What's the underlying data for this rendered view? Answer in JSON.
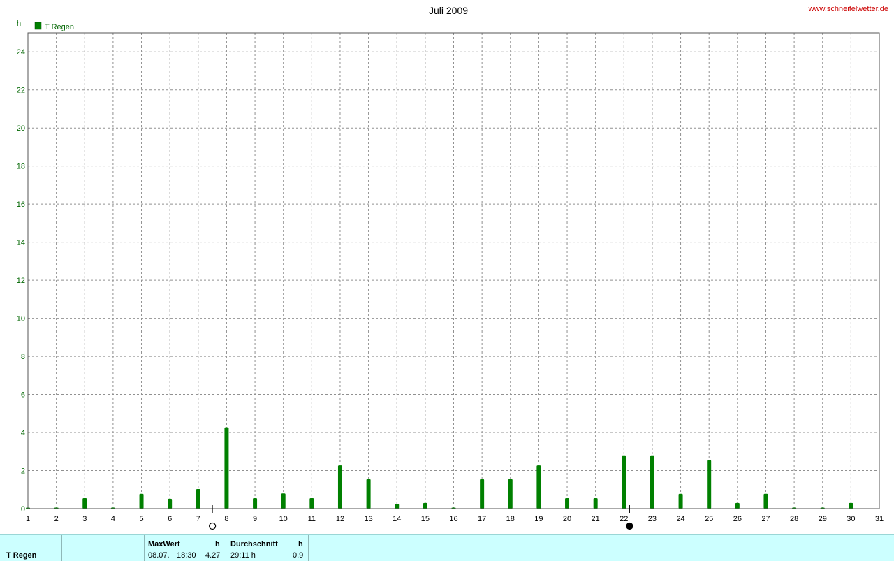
{
  "header": {
    "title": "Juli 2009",
    "site": "www.schneifelwetter.de",
    "y_unit": "h"
  },
  "chart_data": {
    "type": "bar",
    "title": "Juli 2009",
    "xlabel": "",
    "ylabel": "h",
    "xlim": [
      1,
      31
    ],
    "ylim": [
      0,
      25
    ],
    "grid": true,
    "legend_position": "top-left",
    "x_ticks": [
      "1",
      "2",
      "3",
      "4",
      "5",
      "6",
      "7",
      "8",
      "9",
      "10",
      "11",
      "12",
      "13",
      "14",
      "15",
      "16",
      "17",
      "18",
      "19",
      "20",
      "21",
      "22",
      "23",
      "24",
      "25",
      "26",
      "27",
      "28",
      "29",
      "30",
      "31"
    ],
    "y_ticks": [
      "0",
      "2",
      "4",
      "6",
      "8",
      "10",
      "12",
      "14",
      "16",
      "18",
      "20",
      "22",
      "24"
    ],
    "series": [
      {
        "name": "T Regen",
        "color": "#008000",
        "x": [
          1,
          2,
          3,
          4,
          5,
          6,
          7,
          8,
          9,
          10,
          11,
          12,
          13,
          14,
          15,
          16,
          17,
          18,
          19,
          20,
          21,
          22,
          23,
          24,
          25,
          26,
          27,
          28,
          29,
          30
        ],
        "values": [
          0.03,
          0.03,
          0.55,
          0.03,
          0.78,
          0.52,
          1.03,
          4.27,
          0.55,
          0.8,
          0.55,
          2.27,
          1.55,
          0.25,
          0.3,
          0.03,
          1.55,
          1.55,
          2.27,
          0.55,
          0.55,
          2.8,
          2.8,
          0.78,
          2.55,
          0.3,
          0.78,
          0.03,
          0.03,
          0.3
        ]
      }
    ],
    "moon_phases": [
      {
        "x": 7.5,
        "phase": "full"
      },
      {
        "x": 22.2,
        "phase": "new"
      }
    ]
  },
  "footer": {
    "series_label": "T Regen",
    "max": {
      "label": "MaxWert",
      "unit": "h",
      "date": "08.07.",
      "time": "18:30",
      "value": "4.27"
    },
    "avg": {
      "label": "Durchschnitt",
      "unit": "h",
      "total": "29:11 h",
      "value": "0.9"
    }
  }
}
